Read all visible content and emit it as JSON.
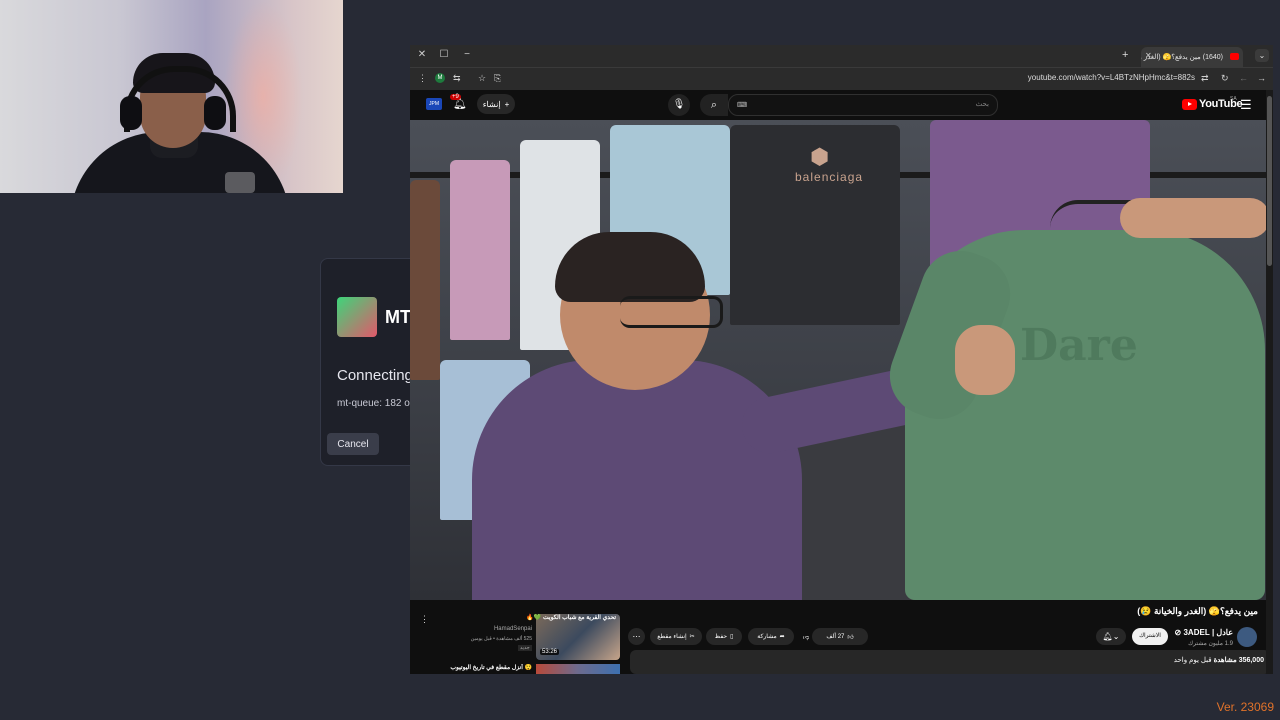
{
  "dialog": {
    "title": "MT",
    "status": "Connecting",
    "queue": "mt-queue: 182 o",
    "cancel_label": "Cancel"
  },
  "browser": {
    "tab_title": "(1640) مين يدفع؟🫣 (الغدر وا",
    "url": "youtube.com/watch?v=L4BTzNHpHmc&t=882s",
    "window_close": "✕",
    "window_max": "☐",
    "window_min": "−",
    "tab_add": "+",
    "tab_menu": "⌄"
  },
  "youtube": {
    "logo_text": "YouTube",
    "country_code": "SA",
    "search_placeholder": "بحث",
    "create_label": "إنشاء",
    "notif_badge": "+9",
    "avatar_text": "JPM"
  },
  "video": {
    "title": "مين يدفع؟🫣 (الغدر والخيانة 😢)",
    "shirt_brand": "balenciaga",
    "shirt_print": "Dare"
  },
  "channel": {
    "name": "عادل | 3ADEL ⊘",
    "subscribers": "1.9 مليون مشترك",
    "subscribe_label": "الاشتراك"
  },
  "actions": {
    "likes": "27 ألف",
    "share": "مشاركة",
    "save": "حفظ",
    "clip": "إنشاء مقطع"
  },
  "description": {
    "views": "356,000 مشاهدة",
    "ago": "قبل يوم واحد"
  },
  "recommendations": [
    {
      "title": "تحدي القرية مع شباب الكويت 💚🔥",
      "channel": "HamadSenpai",
      "meta": "525 ألف مشاهدة • قبل يومين",
      "badge": "جديد",
      "duration": "53:26"
    },
    {
      "title": "😲 أنزل مقطع في تاريخ اليوتيوب"
    }
  ],
  "version": "Ver. 23069"
}
